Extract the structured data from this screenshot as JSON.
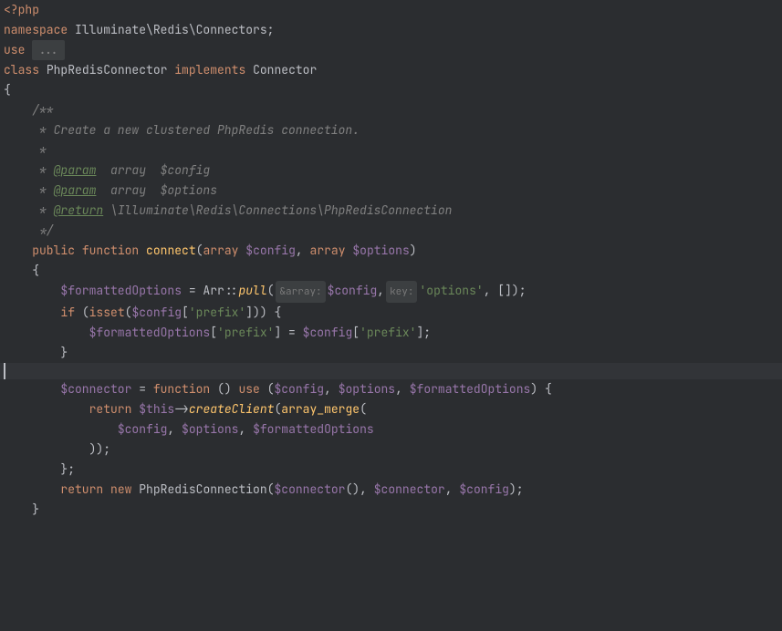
{
  "l1": {
    "open": "<?php"
  },
  "l3": {
    "ns": "namespace",
    "path": "Illuminate\\Redis\\Connectors",
    "semi": ";"
  },
  "l5": {
    "use": "use",
    "fold": "..."
  },
  "l7": {
    "class": "class",
    "name": "PhpRedisConnector",
    "impl": "implements",
    "iface": "Connector"
  },
  "l8": {
    "brace": "{"
  },
  "l9": {
    "c": "    /**"
  },
  "l10": {
    "c": "     * Create a new clustered PhpRedis connection."
  },
  "l11": {
    "c": "     *"
  },
  "l12": {
    "pre": "     * ",
    "tag": "@param",
    "type": "  array  ",
    "var": "$config"
  },
  "l13": {
    "pre": "     * ",
    "tag": "@param",
    "type": "  array  ",
    "var": "$options"
  },
  "l14": {
    "pre": "     * ",
    "tag": "@return",
    "path": " \\Illuminate\\Redis\\Connections\\PhpRedisConnection"
  },
  "l15": {
    "c": "     */"
  },
  "l16": {
    "public": "public",
    "function": "function",
    "name": "connect",
    "p1": "(",
    "arr1": "array",
    "v1": "$config",
    "comma1": ",",
    "arr2": "array",
    "v2": "$options",
    "p2": ")"
  },
  "l17": {
    "brace": "    {"
  },
  "l18": {
    "v1": "$formattedOptions",
    "eq": " = ",
    "cls": "Arr",
    "dbl": "::",
    "method": "pull",
    "p1": "(",
    "hint1": "&array:",
    "v2": "$config",
    "c1": ",",
    "hint2": "key:",
    "s1": "'options'",
    "c2": ",",
    "arr": " []",
    "p2": ")",
    "semi": ";"
  },
  "l20": {
    "if": "if",
    "p1": " (",
    "isset": "isset",
    "p2": "(",
    "v1": "$config",
    "b1": "[",
    "s1": "'prefix'",
    "b2": "]",
    "p3": "))",
    "brace": " {"
  },
  "l21": {
    "v1": "$formattedOptions",
    "b1": "[",
    "s1": "'prefix'",
    "b2": "]",
    "eq": " = ",
    "v2": "$config",
    "b3": "[",
    "s2": "'prefix'",
    "b4": "]",
    "semi": ";"
  },
  "l22": {
    "brace": "        }"
  },
  "l24": {
    "v1": "$connector",
    "eq": " = ",
    "fn": "function",
    "p1": " () ",
    "use": "use",
    "p2": " (",
    "v2": "$config",
    "c1": ",",
    "v3": "$options",
    "c2": ",",
    "v4": "$formattedOptions",
    "p3": ")",
    "brace": " {"
  },
  "l25": {
    "ret": "return",
    "v1": "$this",
    "arrow": "->",
    "method": "createClient",
    "p1": "(",
    "fn": "array_merge",
    "p2": "("
  },
  "l26": {
    "v1": "$config",
    "c1": ",",
    "v2": "$options",
    "c2": ",",
    "v3": "$formattedOptions"
  },
  "l27": {
    "p": "            ))",
    "semi": ";"
  },
  "l28": {
    "brace": "        }",
    "semi": ";"
  },
  "l30": {
    "ret": "return",
    "new": "new",
    "cls": "PhpRedisConnection",
    "p1": "(",
    "v1": "$connector",
    "p2": "()",
    "c1": ",",
    "v2": "$connector",
    "c2": ",",
    "v3": "$config",
    "p3": ")",
    "semi": ";"
  },
  "l31": {
    "brace": "    }"
  }
}
